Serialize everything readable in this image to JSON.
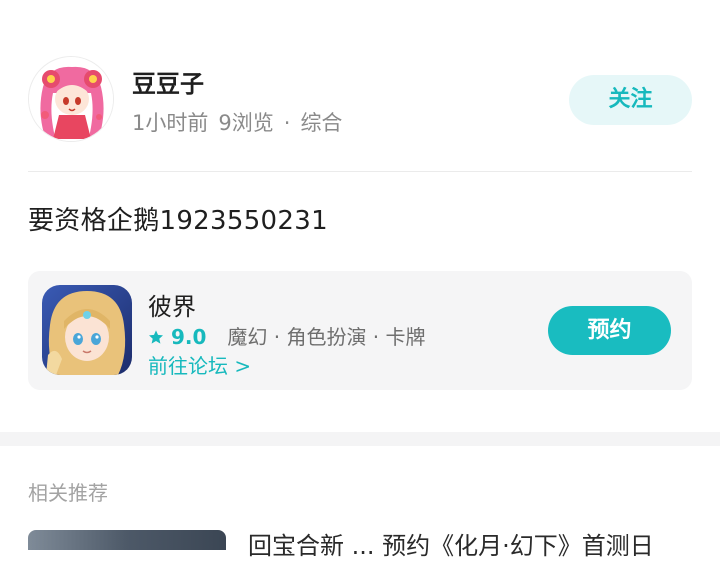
{
  "post": {
    "username": "豆豆子",
    "time": "1小时前",
    "views": "9浏览",
    "separator": "·",
    "category": "综合",
    "follow_label": "关注",
    "content": "要资格企鹅1923550231"
  },
  "game": {
    "name": "彼界",
    "rating": "9.0",
    "tags": [
      "魔幻",
      "角色扮演",
      "卡牌"
    ],
    "forum_link": "前往论坛 >",
    "reserve_label": "预约"
  },
  "related": {
    "title": "相关推荐",
    "first_item_text": "回宝合新 ... 预约《化月·幻下》首测日"
  },
  "colors": {
    "accent": "#19bcc0",
    "follow_bg": "#e6f7f8",
    "card_bg": "#f5f5f6"
  },
  "icons": {
    "rating": "star-icon",
    "forum_arrow": "chevron-right-icon"
  }
}
